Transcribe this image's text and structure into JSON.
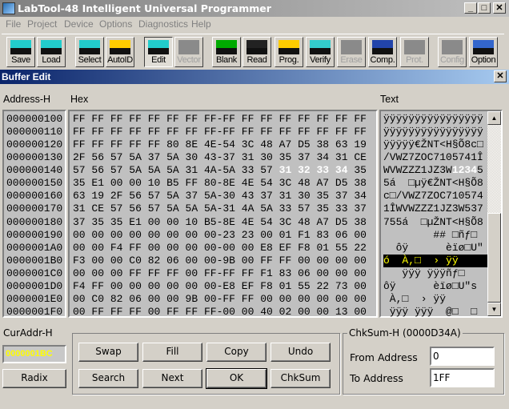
{
  "window": {
    "title": "LabTool-48 Intelligent Universal Programmer",
    "minimize": "_",
    "maximize": "□",
    "close": "✕"
  },
  "menu": [
    "File",
    "Project",
    "Device",
    "Options",
    "Diagnostics",
    "Help"
  ],
  "toolbar": [
    {
      "label": "Save",
      "icon": "save-icon",
      "enabled": true
    },
    {
      "label": "Load",
      "icon": "load-icon",
      "enabled": true
    },
    {
      "label": "Select",
      "icon": "select-icon",
      "enabled": true
    },
    {
      "label": "AutoID",
      "icon": "autoid-icon",
      "enabled": true
    },
    {
      "label": "Edit",
      "icon": "edit-icon",
      "enabled": true,
      "pressed": true
    },
    {
      "label": "Vector",
      "icon": "vector-icon",
      "enabled": false
    },
    {
      "label": "Blank",
      "icon": "blank-icon",
      "enabled": true
    },
    {
      "label": "Read",
      "icon": "read-icon",
      "enabled": true
    },
    {
      "label": "Prog.",
      "icon": "program-icon",
      "enabled": true
    },
    {
      "label": "Verify",
      "icon": "verify-icon",
      "enabled": true
    },
    {
      "label": "Erase",
      "icon": "erase-icon",
      "enabled": false
    },
    {
      "label": "Comp.",
      "icon": "compare-icon",
      "enabled": true
    },
    {
      "label": "Prot.",
      "icon": "protect-icon",
      "enabled": false
    },
    {
      "label": "Config",
      "icon": "config-icon",
      "enabled": false
    },
    {
      "label": "Option",
      "icon": "option-icon",
      "enabled": true
    }
  ],
  "buffer_edit": {
    "title": "Buffer Edit",
    "close": "✕",
    "address_header": "Address-H",
    "hex_header": "Hex",
    "text_header": "Text",
    "addresses": [
      "000000100",
      "000000110",
      "000000120",
      "000000130",
      "000000140",
      "000000150",
      "000000160",
      "000000170",
      "000000180",
      "000000190",
      "0000001A0",
      "0000001B0",
      "0000001C0",
      "0000001D0",
      "0000001E0",
      "0000001F0"
    ],
    "hex_rows": [
      [
        "FF",
        "FF",
        "FF",
        "FF",
        "FF",
        "FF",
        "FF",
        "FF",
        "FF",
        "FF",
        "FF",
        "FF",
        "FF",
        "FF",
        "FF",
        "FF"
      ],
      [
        "FF",
        "FF",
        "FF",
        "FF",
        "FF",
        "FF",
        "FF",
        "FF",
        "FF",
        "FF",
        "FF",
        "FF",
        "FF",
        "FF",
        "FF",
        "FF"
      ],
      [
        "FF",
        "FF",
        "FF",
        "FF",
        "FF",
        "80",
        "8E",
        "4E",
        "54",
        "3C",
        "48",
        "A7",
        "D5",
        "38",
        "63",
        "19"
      ],
      [
        "2F",
        "56",
        "57",
        "5A",
        "37",
        "5A",
        "30",
        "43",
        "37",
        "31",
        "30",
        "35",
        "37",
        "34",
        "31",
        "CE"
      ],
      [
        "57",
        "56",
        "57",
        "5A",
        "5A",
        "5A",
        "31",
        "4A",
        "5A",
        "33",
        "57",
        "31",
        "32",
        "33",
        "34",
        "35"
      ],
      [
        "35",
        "E1",
        "00",
        "00",
        "10",
        "B5",
        "FF",
        "80",
        "8E",
        "4E",
        "54",
        "3C",
        "48",
        "A7",
        "D5",
        "38"
      ],
      [
        "63",
        "19",
        "2F",
        "56",
        "57",
        "5A",
        "37",
        "5A",
        "30",
        "43",
        "37",
        "31",
        "30",
        "35",
        "37",
        "34"
      ],
      [
        "31",
        "CE",
        "57",
        "56",
        "57",
        "5A",
        "5A",
        "5A",
        "31",
        "4A",
        "5A",
        "33",
        "57",
        "35",
        "33",
        "37"
      ],
      [
        "37",
        "35",
        "35",
        "E1",
        "00",
        "00",
        "10",
        "B5",
        "8E",
        "4E",
        "54",
        "3C",
        "48",
        "A7",
        "D5",
        "38"
      ],
      [
        "00",
        "00",
        "00",
        "00",
        "00",
        "00",
        "00",
        "00",
        "23",
        "23",
        "00",
        "01",
        "F1",
        "83",
        "06",
        "00"
      ],
      [
        "00",
        "00",
        "F4",
        "FF",
        "00",
        "00",
        "00",
        "00",
        "00",
        "00",
        "E8",
        "EF",
        "F8",
        "01",
        "55",
        "22"
      ],
      [
        "F3",
        "00",
        "00",
        "C0",
        "82",
        "06",
        "00",
        "00",
        "9B",
        "00",
        "FF",
        "FF",
        "00",
        "00",
        "00",
        "00"
      ],
      [
        "00",
        "00",
        "00",
        "FF",
        "FF",
        "FF",
        "00",
        "FF",
        "FF",
        "FF",
        "F1",
        "83",
        "06",
        "00",
        "00",
        "00"
      ],
      [
        "F4",
        "FF",
        "00",
        "00",
        "00",
        "00",
        "00",
        "00",
        "E8",
        "EF",
        "F8",
        "01",
        "55",
        "22",
        "73",
        "00"
      ],
      [
        "00",
        "C0",
        "82",
        "06",
        "00",
        "00",
        "9B",
        "00",
        "FF",
        "FF",
        "00",
        "00",
        "00",
        "00",
        "00",
        "00"
      ],
      [
        "00",
        "FF",
        "FF",
        "FF",
        "00",
        "FF",
        "FF",
        "FF",
        "00",
        "00",
        "40",
        "02",
        "00",
        "00",
        "13",
        "00"
      ]
    ],
    "text_rows": [
      "ÿÿÿÿÿÿÿÿÿÿÿÿÿÿÿÿ",
      "ÿÿÿÿÿÿÿÿÿÿÿÿÿÿÿÿ",
      "ÿÿÿÿÿ€ŽNT<H§Õ8c□",
      "/VWZ7ZOC7105741Î",
      "WVWZZZ1JZ3W12345",
      "5á  □µÿ€ŽNT<H§Õ8",
      "c□/VWZ7ZOC710574",
      "1ÎWVWZZZ1JZ3W537",
      "755á  □µŽNT<H§Õ8",
      "        ## □ñƒ□ ",
      "  ôÿ      èïø□U\"",
      "ó  À,□  › ÿÿ    ",
      "   ÿÿÿ ÿÿÿñƒ□   ",
      "ôÿ      èïø□U\"s ",
      " À,□  › ÿÿ      ",
      " ÿÿÿ ÿÿÿ  @□  □ "
    ],
    "highlight": {
      "row": 4,
      "from": 11,
      "to": 14,
      "color": "#ffffff"
    },
    "selected_text_row": 11,
    "selection_colors": {
      "background": "#000000",
      "text": "#ffff00"
    }
  },
  "bottom": {
    "curaddr_label": "CurAddr-H",
    "curaddr_value": "0000001BC",
    "curaddr_color": "#ffff00",
    "radix": "Radix",
    "buttons": [
      "Swap",
      "Fill",
      "Copy",
      "Undo",
      "Search",
      "Next",
      "OK",
      "ChkSum"
    ],
    "chksum_legend": "ChkSum-H (0000D34A)",
    "from_label": "From Address",
    "from_value": "0",
    "to_label": "To Address",
    "to_value": "1FF"
  }
}
